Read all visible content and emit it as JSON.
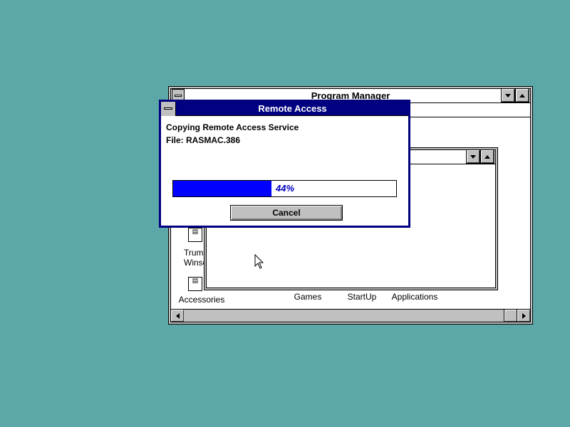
{
  "program_manager": {
    "title": "Program Manager",
    "groups": [
      {
        "label": "Accessories"
      },
      {
        "label": "Games"
      },
      {
        "label": "StartUp"
      },
      {
        "label": "Applications"
      }
    ],
    "partial_icon_label_line1": "Trump",
    "partial_icon_label_line2": "Winso"
  },
  "dialog": {
    "title": "Remote Access",
    "message": "Copying Remote Access Service",
    "file_label": "File: RASMAC.386",
    "progress_percent": 44,
    "progress_text": "44%",
    "cancel_label": "Cancel"
  },
  "colors": {
    "desktop": "#5ca7a7",
    "dialog_frame": "#000080",
    "progress_fill": "#0000ff"
  }
}
